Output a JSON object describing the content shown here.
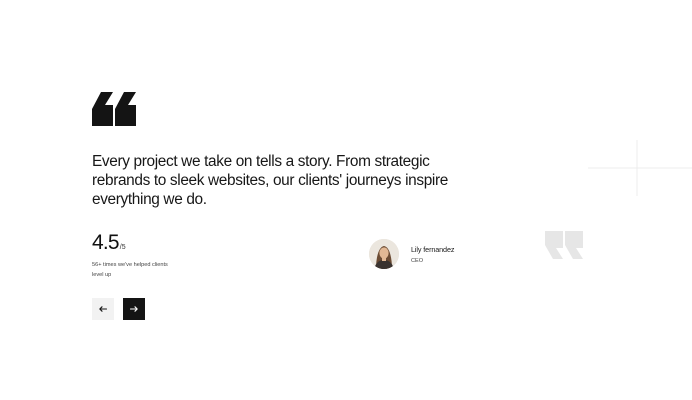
{
  "testimonial": {
    "quote": "Every project we take on tells a story. From strategic rebrands to sleek websites, our clients' journeys inspire everything we do.",
    "rating": {
      "value": "4.5",
      "max": "/5",
      "caption": "56+ times we've helped clients level up"
    },
    "author": {
      "name": "Lily fernandez",
      "role": "CEO"
    }
  },
  "icons": {
    "open_quote": "quote-open-icon",
    "close_quote": "quote-close-icon",
    "prev": "arrow-left-icon",
    "next": "arrow-right-icon"
  },
  "colors": {
    "text": "#171717",
    "next_button": "#141414",
    "prev_button": "#f2f2f2",
    "decor_quote": "#e6e6e6",
    "decor_lines": "#ececec"
  }
}
